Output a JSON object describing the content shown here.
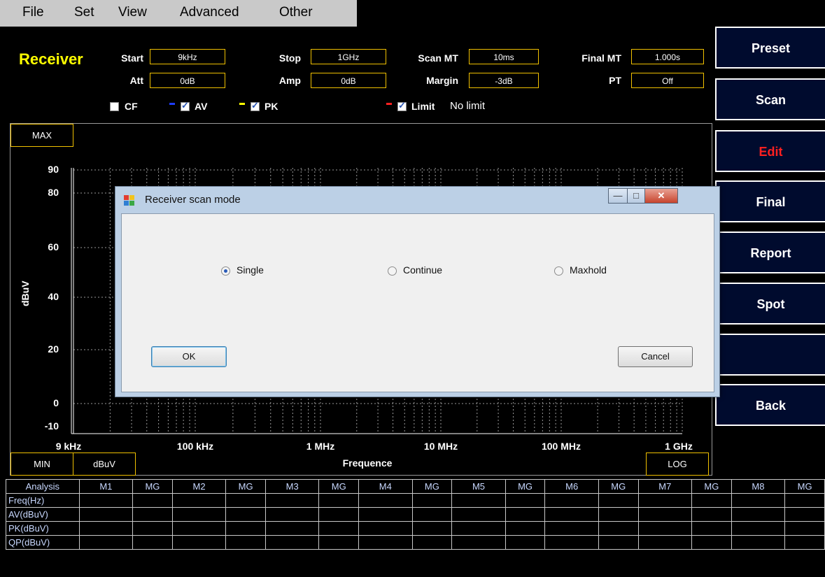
{
  "menu": [
    "File",
    "Set",
    "View",
    "Advanced",
    "Other"
  ],
  "header": {
    "title": "Receiver",
    "params": {
      "start_label": "Start",
      "start_value": "9kHz",
      "stop_label": "Stop",
      "stop_value": "1GHz",
      "scan_mt_label": "Scan MT",
      "scan_mt_value": "10ms",
      "final_mt_label": "Final MT",
      "final_mt_value": "1.000s",
      "att_label": "Att",
      "att_value": "0dB",
      "amp_label": "Amp",
      "amp_value": "0dB",
      "margin_label": "Margin",
      "margin_value": "-3dB",
      "pt_label": "PT",
      "pt_value": "Off"
    },
    "traces": {
      "cf_label": "CF",
      "cf_checked": false,
      "av_label": "AV",
      "av_checked": true,
      "av_color": "#1e3cff",
      "pk_label": "PK",
      "pk_checked": true,
      "pk_color": "#ffff00",
      "limit_label": "Limit",
      "limit_checked": true,
      "limit_color": "#ff2020",
      "limit_text": "No limit"
    }
  },
  "sidebar": {
    "preset": "Preset",
    "scan": "Scan",
    "edit": "Edit",
    "final": "Final",
    "report": "Report",
    "spot": "Spot",
    "back": "Back",
    "edit_color": "#ff2020"
  },
  "plot": {
    "max_label": "MAX",
    "min_label": "MIN",
    "unit_label": "dBuV",
    "ylabel": "dBuV",
    "xlabel": "Frequence",
    "scale_label": "LOG",
    "y_ticks": [
      "90",
      "80",
      "60",
      "40",
      "20",
      "0",
      "-10"
    ],
    "x_ticks": [
      "9 kHz",
      "100 kHz",
      "1 MHz",
      "10 MHz",
      "100 MHz",
      "1 GHz"
    ]
  },
  "table": {
    "headers": [
      "Analysis",
      "M1",
      "MG",
      "M2",
      "MG",
      "M3",
      "MG",
      "M4",
      "MG",
      "M5",
      "MG",
      "M6",
      "MG",
      "M7",
      "MG",
      "M8",
      "MG"
    ],
    "row_labels": [
      "Freq(Hz)",
      "AV(dBuV)",
      "PK(dBuV)",
      "QP(dBuV)"
    ]
  },
  "dialog": {
    "title": "Receiver scan mode",
    "options": [
      "Single",
      "Continue",
      "Maxhold"
    ],
    "selected": "Single",
    "ok_label": "OK",
    "cancel_label": "Cancel",
    "minimize_icon": "minimize-icon",
    "maximize_icon": "maximize-icon",
    "close_icon": "close-icon"
  }
}
